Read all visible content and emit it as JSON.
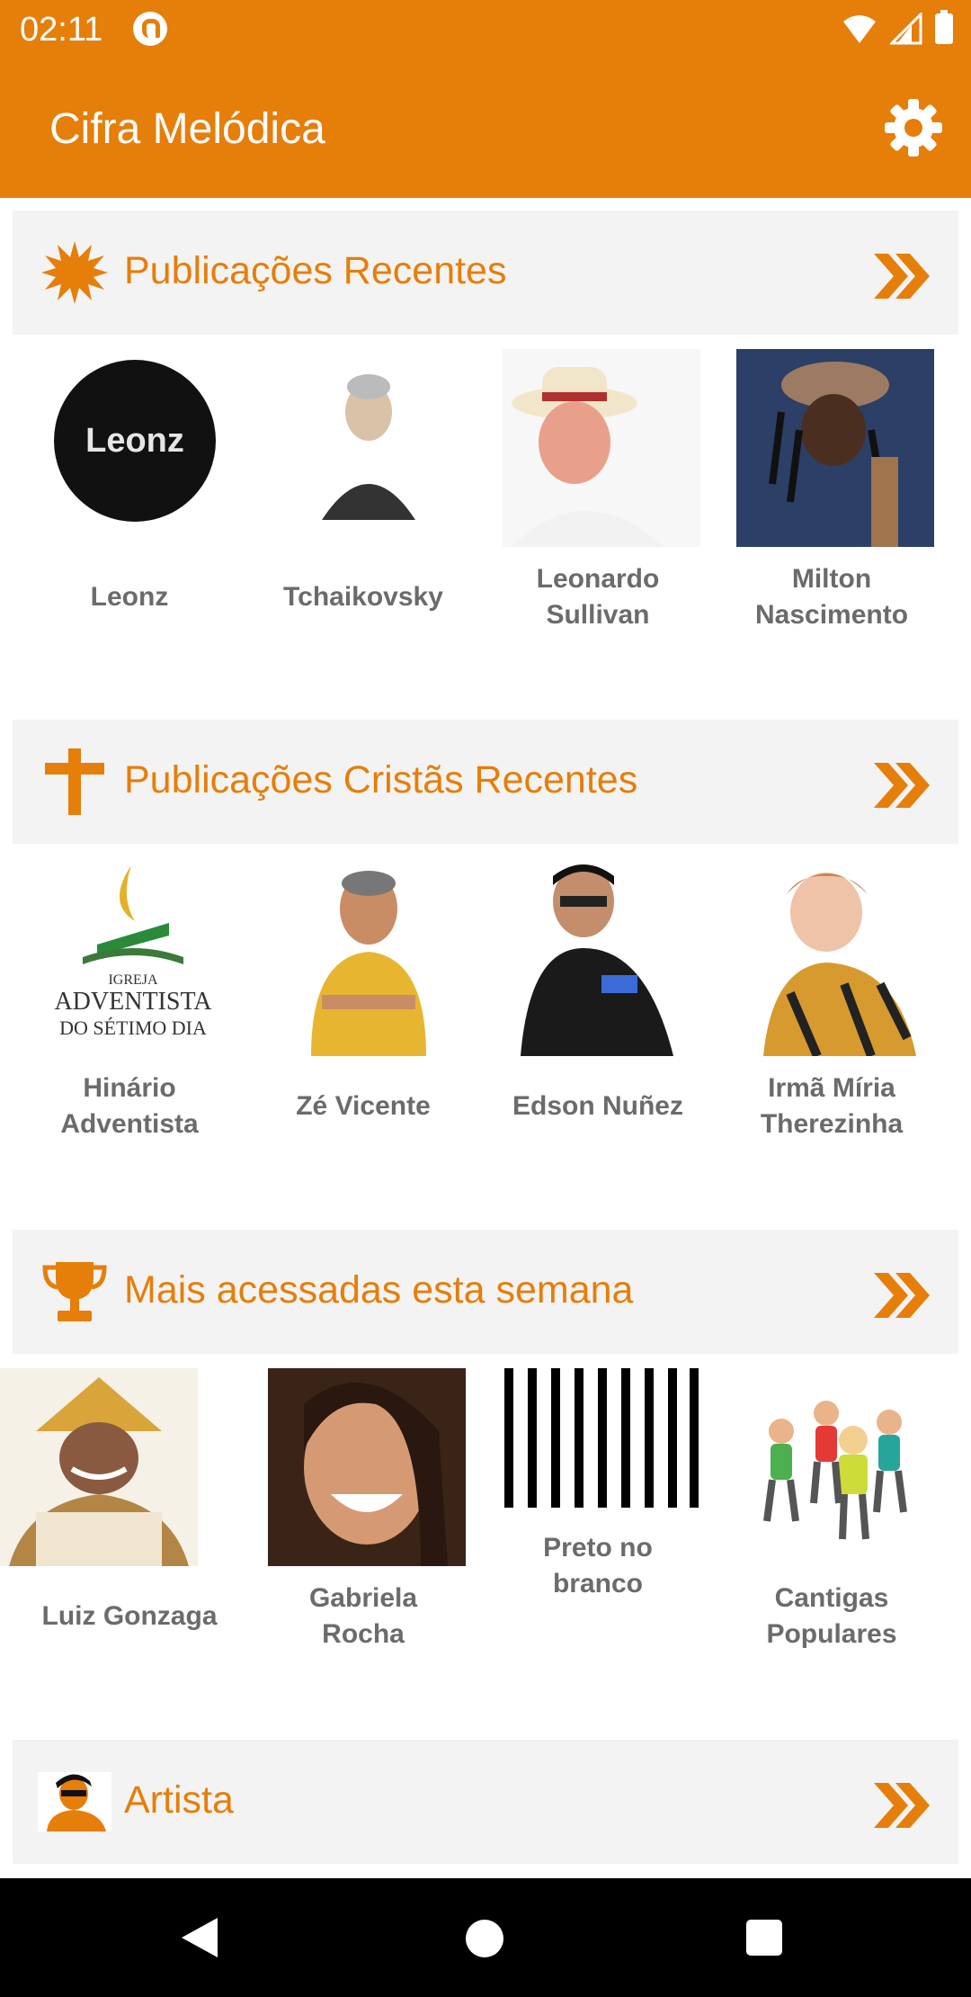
{
  "status_bar": {
    "time": "02:11",
    "icons": [
      "app-notification-icon",
      "wifi-icon",
      "signal-icon",
      "battery-icon"
    ]
  },
  "app_bar": {
    "title": "Cifra Melódica",
    "settings_icon": "gear-icon"
  },
  "colors": {
    "accent": "#E67E0A",
    "section_bg": "#F3F3F3",
    "label": "#6b6b6b"
  },
  "sections": [
    {
      "title": "Publicações Recentes",
      "icon": "sunburst-icon",
      "items": [
        {
          "label": "Leonz",
          "image": "leonz-logo"
        },
        {
          "label": "Tchaikovsky",
          "image": "portrait"
        },
        {
          "label": "Leonardo\nSullivan",
          "image": "portrait"
        },
        {
          "label": "Milton\nNascimento",
          "image": "portrait"
        }
      ]
    },
    {
      "title": "Publicações Cristãs Recentes",
      "icon": "cross-icon",
      "items": [
        {
          "label": "Hinário\nAdventista",
          "image": "adventist-logo",
          "logo_text": [
            "IGREJA",
            "ADVENTISTA",
            "DO SÉTIMO DIA"
          ]
        },
        {
          "label": "Zé Vicente",
          "image": "portrait"
        },
        {
          "label": "Edson Nuñez",
          "image": "portrait"
        },
        {
          "label": "Irmã Míria\nTherezinha",
          "image": "portrait"
        }
      ]
    },
    {
      "title": "Mais acessadas esta semana",
      "icon": "trophy-icon",
      "items": [
        {
          "label": "Luiz Gonzaga",
          "image": "portrait"
        },
        {
          "label": "Gabriela\nRocha",
          "image": "portrait"
        },
        {
          "label": "Preto no\nbranco",
          "image": "stripes"
        },
        {
          "label": "Cantigas\nPopulares",
          "image": "children-illustration"
        }
      ]
    },
    {
      "title": "Artista",
      "icon": "artist-icon",
      "items": []
    }
  ],
  "nav_bar": {
    "icons": [
      "back-icon",
      "home-icon",
      "recents-icon"
    ]
  }
}
